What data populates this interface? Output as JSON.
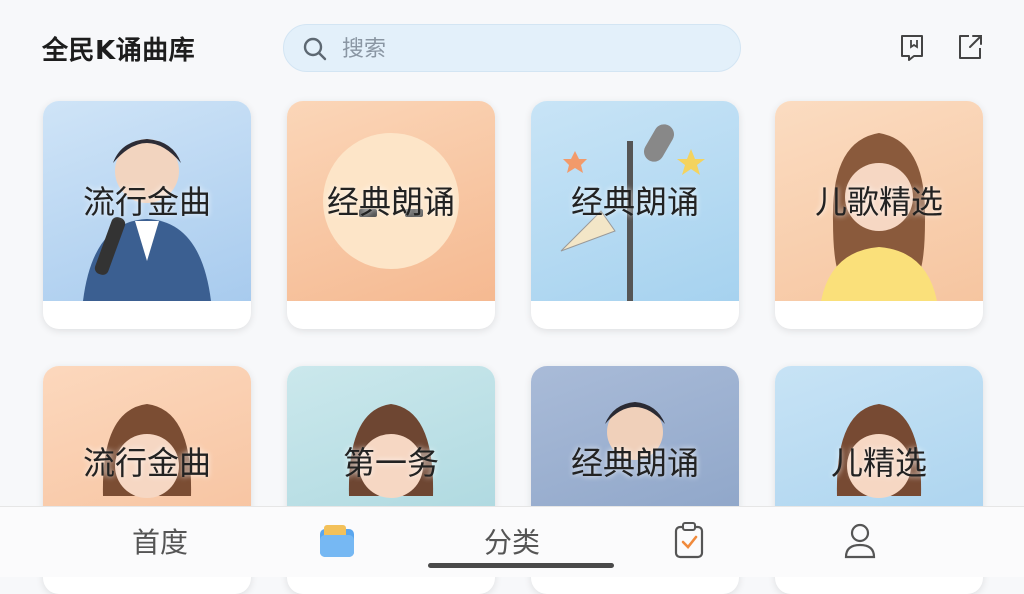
{
  "header": {
    "title": "全民K诵曲库",
    "search_placeholder": "搜索",
    "icons": [
      "bookmark-icon",
      "share-icon"
    ]
  },
  "cards": [
    {
      "label": "流行金曲",
      "bg": "#b7d6f2"
    },
    {
      "label": "经典朗诵",
      "bg": "#f8c9a4"
    },
    {
      "label": "经典朗诵",
      "bg": "#b9dcf2"
    },
    {
      "label": "儿歌精选",
      "bg": "#f8d2b0"
    },
    {
      "label": "流行金曲",
      "bg": "#f8cfb2"
    },
    {
      "label": "第一务",
      "bg": "#bfe1e6"
    },
    {
      "label": "经典朗诵",
      "bg": "#9bb0cf"
    },
    {
      "label": "儿精选",
      "bg": "#b9dcf0"
    }
  ],
  "tabbar": {
    "tabs": [
      {
        "label": "首度"
      },
      {
        "label": ""
      },
      {
        "label": "分类"
      },
      {
        "label": ""
      },
      {
        "label": ""
      }
    ]
  },
  "colors": {
    "accent": "#3a8de0",
    "search_bg": "#e3f0fa"
  }
}
